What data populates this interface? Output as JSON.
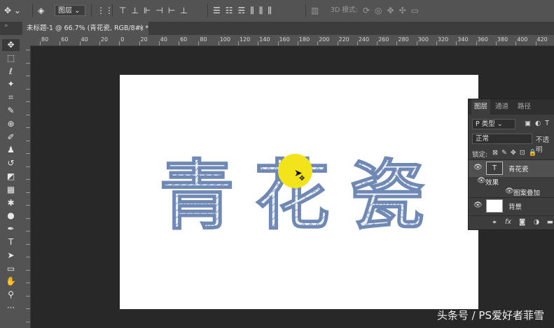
{
  "options_bar": {
    "move_icon": "move-tool-icon",
    "dropdown_value": "图层",
    "mode_3d_label": "3D 模式:"
  },
  "document_tab": {
    "title": "未标题-1 @ 66.7% (青花瓷, RGB/8#) *",
    "close_label": "×"
  },
  "ruler": {
    "labels": [
      "80",
      "60",
      "40",
      "20",
      "0",
      "20",
      "40",
      "60",
      "80",
      "100",
      "120",
      "140",
      "160",
      "180",
      "200",
      "220",
      "240",
      "260",
      "280",
      "300",
      "320",
      "340",
      "360",
      "380",
      "400",
      "420"
    ]
  },
  "tools": [
    {
      "name": "move-tool",
      "glyph": "✥"
    },
    {
      "name": "marquee-tool",
      "glyph": "⬚"
    },
    {
      "name": "lasso-tool",
      "glyph": "ℓ"
    },
    {
      "name": "magic-wand-tool",
      "glyph": "✦"
    },
    {
      "name": "crop-tool",
      "glyph": "⌗"
    },
    {
      "name": "eyedropper-tool",
      "glyph": "✎"
    },
    {
      "name": "healing-tool",
      "glyph": "⊕"
    },
    {
      "name": "brush-tool",
      "glyph": "✐"
    },
    {
      "name": "stamp-tool",
      "glyph": "♟"
    },
    {
      "name": "history-brush-tool",
      "glyph": "↺"
    },
    {
      "name": "eraser-tool",
      "glyph": "◩"
    },
    {
      "name": "gradient-tool",
      "glyph": "▦"
    },
    {
      "name": "blur-tool",
      "glyph": "✱"
    },
    {
      "name": "dodge-tool",
      "glyph": "●"
    },
    {
      "name": "pen-tool",
      "glyph": "✒"
    },
    {
      "name": "type-tool",
      "glyph": "T"
    },
    {
      "name": "path-selection-tool",
      "glyph": "➤"
    },
    {
      "name": "shape-tool",
      "glyph": "▭"
    },
    {
      "name": "hand-tool",
      "glyph": "✋"
    },
    {
      "name": "zoom-tool",
      "glyph": "⚲"
    },
    {
      "name": "more-tools",
      "glyph": "···"
    }
  ],
  "layers_panel": {
    "tabs": [
      "图层",
      "通道",
      "路径"
    ],
    "filter_label": "P 类型",
    "blend_mode": "正常",
    "opacity_label": "不透明",
    "lock_label": "锁定:",
    "layers": [
      {
        "name": "青花瓷",
        "thumb": "T",
        "selected": true
      },
      {
        "name": "效果",
        "sub": true
      },
      {
        "name": "图案叠加",
        "sub2": true
      },
      {
        "name": "背景",
        "thumb": ""
      }
    ],
    "footer_icons": [
      "link-icon",
      "fx-icon",
      "mask-icon",
      "adjustment-icon",
      "folder-icon"
    ],
    "fx_label": "fx"
  },
  "canvas_text": "青花瓷",
  "watermark": "头条号 / PS爱好者菲雪",
  "colors": {
    "highlight": "#f2e31a",
    "porcelain_blue": "#8fa6c9"
  }
}
